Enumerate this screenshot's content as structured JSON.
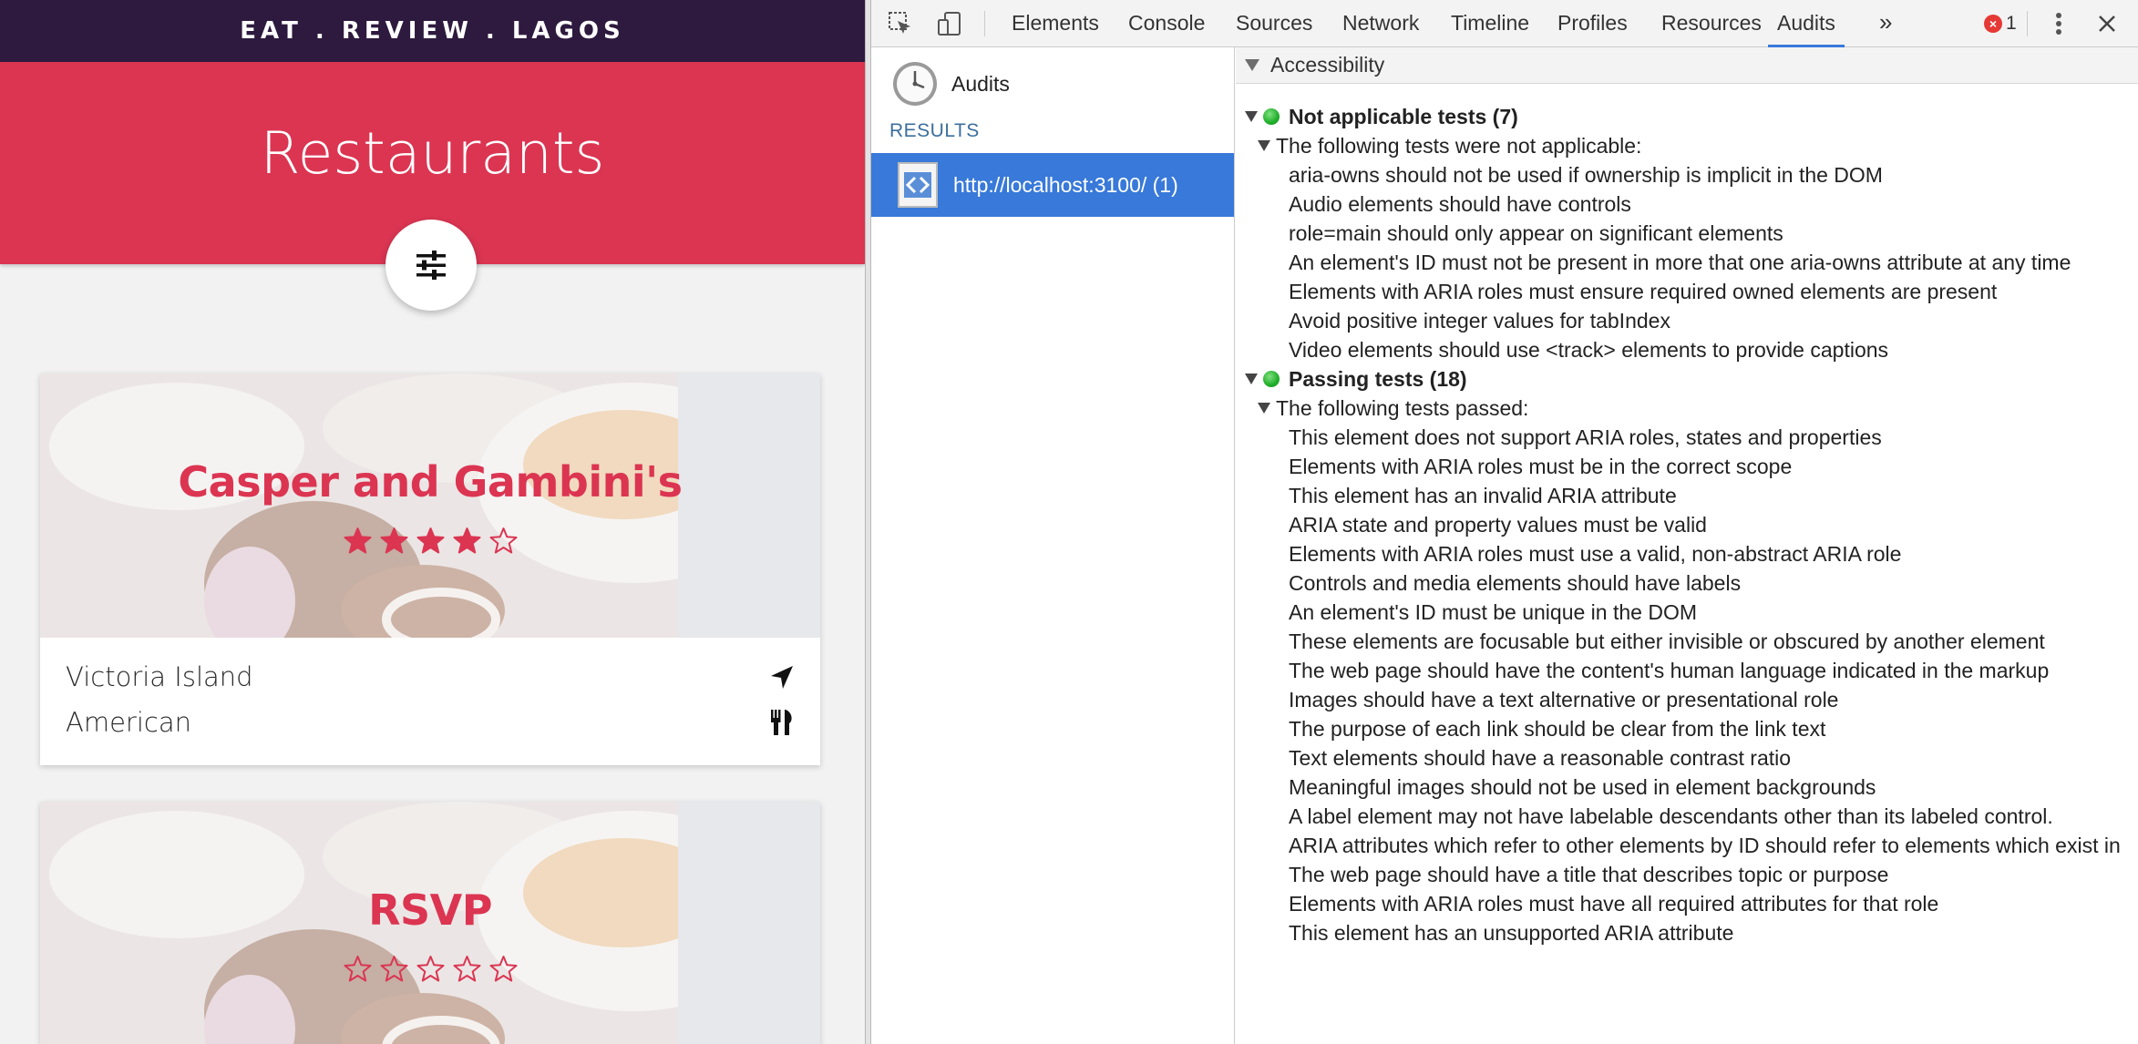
{
  "app": {
    "brand": "EAT . REVIEW . LAGOS",
    "title": "Restaurants",
    "filter_icon": "sliders-icon",
    "restaurants": [
      {
        "name": "Casper and Gambini's",
        "rating": 4,
        "max_rating": 5,
        "location": "Victoria Island",
        "cuisine": "American"
      },
      {
        "name": "RSVP",
        "rating": 0,
        "max_rating": 5
      }
    ],
    "colors": {
      "topbar": "#2e1a3e",
      "accent": "#db3552"
    }
  },
  "devtools": {
    "tabs": [
      "Elements",
      "Console",
      "Sources",
      "Network",
      "Timeline",
      "Profiles",
      "Resources",
      "Audits"
    ],
    "active_tab": "Audits",
    "more_tabs": "»",
    "error_count": "1",
    "sidebar": {
      "audits_label": "Audits",
      "results_heading": "RESULTS",
      "result_item": "http://localhost:3100/ (1)"
    },
    "main": {
      "section": "Accessibility",
      "groups": [
        {
          "label": "Not applicable tests (7)",
          "subheading": "The following tests were not applicable:",
          "items": [
            "aria-owns should not be used if ownership is implicit in the DOM",
            "Audio elements should have controls",
            "role=main should only appear on significant elements",
            "An element's ID must not be present in more that one aria-owns attribute at any time",
            "Elements with ARIA roles must ensure required owned elements are present",
            "Avoid positive integer values for tabIndex",
            "Video elements should use <track> elements to provide captions"
          ]
        },
        {
          "label": "Passing tests (18)",
          "subheading": "The following tests passed:",
          "items": [
            "This element does not support ARIA roles, states and properties",
            "Elements with ARIA roles must be in the correct scope",
            "This element has an invalid ARIA attribute",
            "ARIA state and property values must be valid",
            "Elements with ARIA roles must use a valid, non-abstract ARIA role",
            "Controls and media elements should have labels",
            "An element's ID must be unique in the DOM",
            "These elements are focusable but either invisible or obscured by another element",
            "The web page should have the content's human language indicated in the markup",
            "Images should have a text alternative or presentational role",
            "The purpose of each link should be clear from the link text",
            "Text elements should have a reasonable contrast ratio",
            "Meaningful images should not be used in element backgrounds",
            "A label element may not have labelable descendants other than its labeled control.",
            "ARIA attributes which refer to other elements by ID should refer to elements which exist in",
            "The web page should have a title that describes topic or purpose",
            "Elements with ARIA roles must have all required attributes for that role",
            "This element has an unsupported ARIA attribute"
          ]
        }
      ]
    }
  }
}
